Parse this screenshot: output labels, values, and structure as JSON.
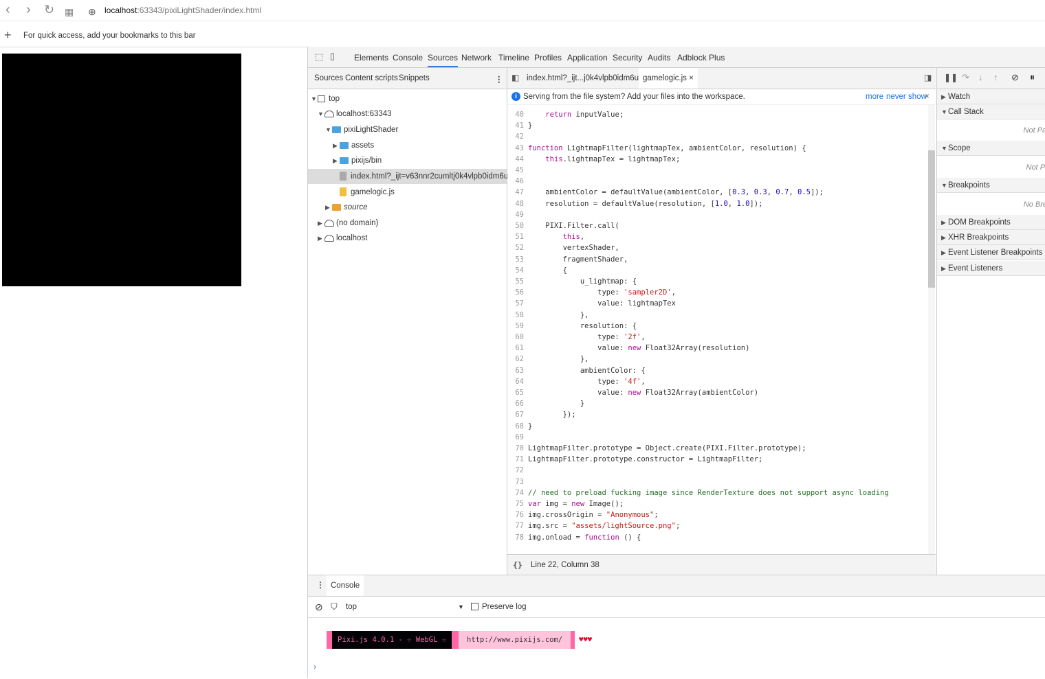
{
  "browser": {
    "url_host": "localhost",
    "url_path": ":63343/pixiLightShader/index.html",
    "bookmarks_hint": "For quick access, add your bookmarks to this bar"
  },
  "devtools": {
    "tabs": [
      "Elements",
      "Console",
      "Sources",
      "Network",
      "Timeline",
      "Profiles",
      "Application",
      "Security",
      "Audits",
      "Adblock Plus"
    ],
    "active_tab": "Sources",
    "navigator": {
      "subtabs": [
        "Sources",
        "Content scripts",
        "Snippets"
      ],
      "tree": [
        {
          "label": "top"
        },
        {
          "label": "localhost:63343"
        },
        {
          "label": "pixiLightShader"
        },
        {
          "label": "assets"
        },
        {
          "label": "pixijs/bin"
        },
        {
          "label": "index.html?_ijt=v63nnr2cumltj0k4vlpb0idm6u"
        },
        {
          "label": "gamelogic.js"
        },
        {
          "label": "source"
        },
        {
          "label": "(no domain)"
        },
        {
          "label": "localhost"
        }
      ]
    },
    "editor": {
      "file_tabs": [
        "index.html?_ijt...j0k4vlpb0idm6u",
        "gamelogic.js ×"
      ],
      "info_message": "Serving from the file system? Add your files into the workspace.",
      "info_more": "more",
      "info_never": "never show",
      "info_close": "×",
      "status": "Line 22, Column 38",
      "lines": [
        {
          "n": "40",
          "t": "    return inputValue;"
        },
        {
          "n": "41",
          "t": "}"
        },
        {
          "n": "42",
          "t": ""
        },
        {
          "n": "43",
          "t": "function LightmapFilter(lightmapTex, ambientColor, resolution) {"
        },
        {
          "n": "44",
          "t": "    this.lightmapTex = lightmapTex;"
        },
        {
          "n": "45",
          "t": ""
        },
        {
          "n": "46",
          "t": ""
        },
        {
          "n": "47",
          "t": "    ambientColor = defaultValue(ambientColor, [0.3, 0.3, 0.7, 0.5]);"
        },
        {
          "n": "48",
          "t": "    resolution = defaultValue(resolution, [1.0, 1.0]);"
        },
        {
          "n": "49",
          "t": ""
        },
        {
          "n": "50",
          "t": "    PIXI.Filter.call("
        },
        {
          "n": "51",
          "t": "        this,"
        },
        {
          "n": "52",
          "t": "        vertexShader,"
        },
        {
          "n": "53",
          "t": "        fragmentShader,"
        },
        {
          "n": "54",
          "t": "        {"
        },
        {
          "n": "55",
          "t": "            u_lightmap: {"
        },
        {
          "n": "56",
          "t": "                type: 'sampler2D',"
        },
        {
          "n": "57",
          "t": "                value: lightmapTex"
        },
        {
          "n": "58",
          "t": "            },"
        },
        {
          "n": "59",
          "t": "            resolution: {"
        },
        {
          "n": "60",
          "t": "                type: '2f',"
        },
        {
          "n": "61",
          "t": "                value: new Float32Array(resolution)"
        },
        {
          "n": "62",
          "t": "            },"
        },
        {
          "n": "63",
          "t": "            ambientColor: {"
        },
        {
          "n": "64",
          "t": "                type: '4f',"
        },
        {
          "n": "65",
          "t": "                value: new Float32Array(ambientColor)"
        },
        {
          "n": "66",
          "t": "            }"
        },
        {
          "n": "67",
          "t": "        });"
        },
        {
          "n": "68",
          "t": "}"
        },
        {
          "n": "69",
          "t": ""
        },
        {
          "n": "70",
          "t": "LightmapFilter.prototype = Object.create(PIXI.Filter.prototype);"
        },
        {
          "n": "71",
          "t": "LightmapFilter.prototype.constructor = LightmapFilter;"
        },
        {
          "n": "72",
          "t": ""
        },
        {
          "n": "73",
          "t": ""
        },
        {
          "n": "74",
          "t": "// need to preload fucking image since RenderTexture does not support async loading"
        },
        {
          "n": "75",
          "t": "var img = new Image();"
        },
        {
          "n": "76",
          "t": "img.crossOrigin = \"Anonymous\";"
        },
        {
          "n": "77",
          "t": "img.src = \"assets/lightSource.png\";"
        },
        {
          "n": "78",
          "t": "img.onload = function () {"
        }
      ]
    },
    "debugger": {
      "sections": [
        {
          "label": "Watch",
          "open": false
        },
        {
          "label": "Call Stack",
          "open": true,
          "note": "Not Paused"
        },
        {
          "label": "Scope",
          "open": true,
          "note": "Not Paused"
        },
        {
          "label": "Breakpoints",
          "open": true,
          "note": "No Breakpoints"
        },
        {
          "label": "DOM Breakpoints",
          "open": false
        },
        {
          "label": "XHR Breakpoints",
          "open": false
        },
        {
          "label": "Event Listener Breakpoints",
          "open": false
        },
        {
          "label": "Event Listeners",
          "open": false
        }
      ]
    },
    "console": {
      "tab": "Console",
      "context": "top",
      "preserve_log": "Preserve log",
      "banner_main": "Pixi.js 4.0.1 - ☆ WebGL ☆",
      "banner_url": "http://www.pixijs.com/",
      "banner_hearts": "♥♥♥"
    }
  }
}
